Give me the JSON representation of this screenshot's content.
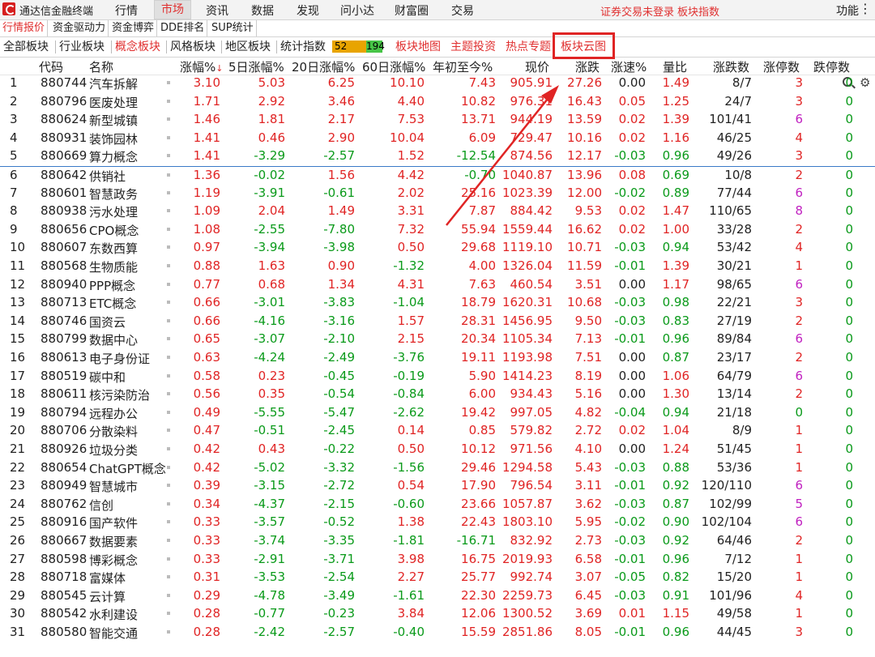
{
  "app": {
    "title": "通达信金融终端"
  },
  "menu": [
    "行情",
    "市场",
    "资讯",
    "数据",
    "发现",
    "问小达",
    "财富圈",
    "交易"
  ],
  "menu_active": "市场",
  "notice": [
    "证券交易未登录",
    "板块指数"
  ],
  "right_menu": "功能",
  "sub_tabs": [
    "行情报价",
    "资金驱动力",
    "资金博弈",
    "DDE排名",
    "SUP统计"
  ],
  "board_tabs": [
    "全部板块",
    "行业板块",
    "概念板块",
    "风格板块",
    "地区板块",
    "统计指数"
  ],
  "board_tabs_active": "概念板块",
  "stat_bar": {
    "up": "52",
    "down": "194"
  },
  "feature_tabs": [
    "板块地图",
    "主题投资",
    "热点专题",
    "板块云图"
  ],
  "highlighted_tab": "板块云图",
  "columns": [
    "代码",
    "名称",
    "涨幅%",
    "5日涨幅%",
    "20日涨幅%",
    "60日涨幅%",
    "年初至今%",
    "现价",
    "涨跌",
    "涨速%",
    "量比",
    "涨跌数",
    "涨停数",
    "跌停数"
  ],
  "rows": [
    [
      "1",
      "880744",
      "汽车拆解",
      "3.10",
      "5.03",
      "6.25",
      "10.10",
      "7.43",
      "905.91",
      "27.26",
      "0.00",
      "1.49",
      "8/7",
      "3",
      "0"
    ],
    [
      "2",
      "880796",
      "医废处理",
      "1.71",
      "2.92",
      "3.46",
      "4.40",
      "10.82",
      "976.31",
      "16.43",
      "0.05",
      "1.25",
      "24/7",
      "3",
      "0"
    ],
    [
      "3",
      "880624",
      "新型城镇",
      "1.46",
      "1.81",
      "2.17",
      "7.53",
      "13.71",
      "944.19",
      "13.59",
      "0.02",
      "1.39",
      "101/41",
      "6",
      "0"
    ],
    [
      "4",
      "880931",
      "装饰园林",
      "1.41",
      "0.46",
      "2.90",
      "10.04",
      "6.09",
      "729.47",
      "10.16",
      "0.02",
      "1.16",
      "46/25",
      "4",
      "0"
    ],
    [
      "5",
      "880669",
      "算力概念",
      "1.41",
      "-3.29",
      "-2.57",
      "1.52",
      "-12.54",
      "874.56",
      "12.17",
      "-0.03",
      "0.96",
      "49/26",
      "3",
      "0"
    ],
    [
      "6",
      "880642",
      "供销社",
      "1.36",
      "-0.02",
      "1.56",
      "4.42",
      "-0.70",
      "1040.87",
      "13.96",
      "0.08",
      "0.69",
      "10/8",
      "2",
      "0"
    ],
    [
      "7",
      "880601",
      "智慧政务",
      "1.19",
      "-3.91",
      "-0.61",
      "2.02",
      "25.16",
      "1023.39",
      "12.00",
      "-0.02",
      "0.89",
      "77/44",
      "6",
      "0"
    ],
    [
      "8",
      "880938",
      "污水处理",
      "1.09",
      "2.04",
      "1.49",
      "3.31",
      "7.87",
      "884.42",
      "9.53",
      "0.02",
      "1.47",
      "110/65",
      "8",
      "0"
    ],
    [
      "9",
      "880656",
      "CPO概念",
      "1.08",
      "-2.55",
      "-7.80",
      "7.32",
      "55.94",
      "1559.44",
      "16.62",
      "0.02",
      "1.00",
      "33/28",
      "2",
      "0"
    ],
    [
      "10",
      "880607",
      "东数西算",
      "0.97",
      "-3.94",
      "-3.98",
      "0.50",
      "29.68",
      "1119.10",
      "10.71",
      "-0.03",
      "0.94",
      "53/42",
      "4",
      "0"
    ],
    [
      "11",
      "880568",
      "生物质能",
      "0.88",
      "1.63",
      "0.90",
      "-1.32",
      "4.00",
      "1326.04",
      "11.59",
      "-0.01",
      "1.39",
      "30/21",
      "1",
      "0"
    ],
    [
      "12",
      "880940",
      "PPP概念",
      "0.77",
      "0.68",
      "1.34",
      "4.31",
      "7.63",
      "460.54",
      "3.51",
      "0.00",
      "1.17",
      "98/65",
      "6",
      "0"
    ],
    [
      "13",
      "880713",
      "ETC概念",
      "0.66",
      "-3.01",
      "-3.83",
      "-1.04",
      "18.79",
      "1620.31",
      "10.68",
      "-0.03",
      "0.98",
      "22/21",
      "3",
      "0"
    ],
    [
      "14",
      "880746",
      "国资云",
      "0.66",
      "-4.16",
      "-3.16",
      "1.57",
      "28.31",
      "1456.95",
      "9.50",
      "-0.03",
      "0.83",
      "27/19",
      "2",
      "0"
    ],
    [
      "15",
      "880799",
      "数据中心",
      "0.65",
      "-3.07",
      "-2.10",
      "2.15",
      "20.34",
      "1105.34",
      "7.13",
      "-0.01",
      "0.96",
      "89/84",
      "6",
      "0"
    ],
    [
      "16",
      "880613",
      "电子身份证",
      "0.63",
      "-4.24",
      "-2.49",
      "-3.76",
      "19.11",
      "1193.98",
      "7.51",
      "0.00",
      "0.87",
      "23/17",
      "2",
      "0"
    ],
    [
      "17",
      "880519",
      "碳中和",
      "0.58",
      "0.23",
      "-0.45",
      "-0.19",
      "5.90",
      "1414.23",
      "8.19",
      "0.00",
      "1.06",
      "64/79",
      "6",
      "0"
    ],
    [
      "18",
      "880611",
      "核污染防治",
      "0.56",
      "0.35",
      "-0.54",
      "-0.84",
      "6.00",
      "934.43",
      "5.16",
      "0.00",
      "1.30",
      "13/14",
      "2",
      "0"
    ],
    [
      "19",
      "880794",
      "远程办公",
      "0.49",
      "-5.55",
      "-5.47",
      "-2.62",
      "19.42",
      "997.05",
      "4.82",
      "-0.04",
      "0.94",
      "21/18",
      "0",
      "0"
    ],
    [
      "20",
      "880706",
      "分散染料",
      "0.47",
      "-0.51",
      "-2.45",
      "0.14",
      "0.85",
      "579.82",
      "2.72",
      "0.02",
      "1.04",
      "8/9",
      "1",
      "0"
    ],
    [
      "21",
      "880926",
      "垃圾分类",
      "0.42",
      "0.43",
      "-0.22",
      "0.50",
      "10.12",
      "971.56",
      "4.10",
      "0.00",
      "1.24",
      "51/45",
      "1",
      "0"
    ],
    [
      "22",
      "880654",
      "ChatGPT概念",
      "0.42",
      "-5.02",
      "-3.32",
      "-1.56",
      "29.46",
      "1294.58",
      "5.43",
      "-0.03",
      "0.88",
      "53/36",
      "1",
      "0"
    ],
    [
      "23",
      "880949",
      "智慧城市",
      "0.39",
      "-3.15",
      "-2.72",
      "0.54",
      "17.90",
      "796.54",
      "3.11",
      "-0.01",
      "0.92",
      "120/110",
      "6",
      "0"
    ],
    [
      "24",
      "880762",
      "信创",
      "0.34",
      "-4.37",
      "-2.15",
      "-0.60",
      "23.66",
      "1057.87",
      "3.62",
      "-0.03",
      "0.87",
      "102/99",
      "5",
      "0"
    ],
    [
      "25",
      "880916",
      "国产软件",
      "0.33",
      "-3.57",
      "-0.52",
      "1.38",
      "22.43",
      "1803.10",
      "5.95",
      "-0.02",
      "0.90",
      "102/104",
      "6",
      "0"
    ],
    [
      "26",
      "880667",
      "数据要素",
      "0.33",
      "-3.74",
      "-3.35",
      "-1.81",
      "-16.71",
      "832.92",
      "2.73",
      "-0.03",
      "0.92",
      "64/46",
      "2",
      "0"
    ],
    [
      "27",
      "880598",
      "博彩概念",
      "0.33",
      "-2.91",
      "-3.71",
      "3.98",
      "16.75",
      "2019.93",
      "6.58",
      "-0.01",
      "0.96",
      "7/12",
      "1",
      "0"
    ],
    [
      "28",
      "880718",
      "富媒体",
      "0.31",
      "-3.53",
      "-2.54",
      "2.27",
      "25.77",
      "992.74",
      "3.07",
      "-0.05",
      "0.82",
      "15/20",
      "1",
      "0"
    ],
    [
      "29",
      "880545",
      "云计算",
      "0.29",
      "-4.78",
      "-3.49",
      "-1.61",
      "22.30",
      "2259.73",
      "6.45",
      "-0.03",
      "0.91",
      "101/96",
      "4",
      "0"
    ],
    [
      "30",
      "880542",
      "水利建设",
      "0.28",
      "-0.77",
      "-0.23",
      "3.84",
      "12.06",
      "1300.52",
      "3.69",
      "0.01",
      "1.15",
      "49/58",
      "1",
      "0"
    ],
    [
      "31",
      "880580",
      "智能交通",
      "0.28",
      "-2.42",
      "-2.57",
      "-0.40",
      "15.59",
      "2851.86",
      "8.05",
      "-0.01",
      "0.96",
      "44/45",
      "3",
      "0"
    ]
  ],
  "colors": {
    "up": "#e02424",
    "down": "#0a9a1a",
    "highlight": "#e02424"
  }
}
